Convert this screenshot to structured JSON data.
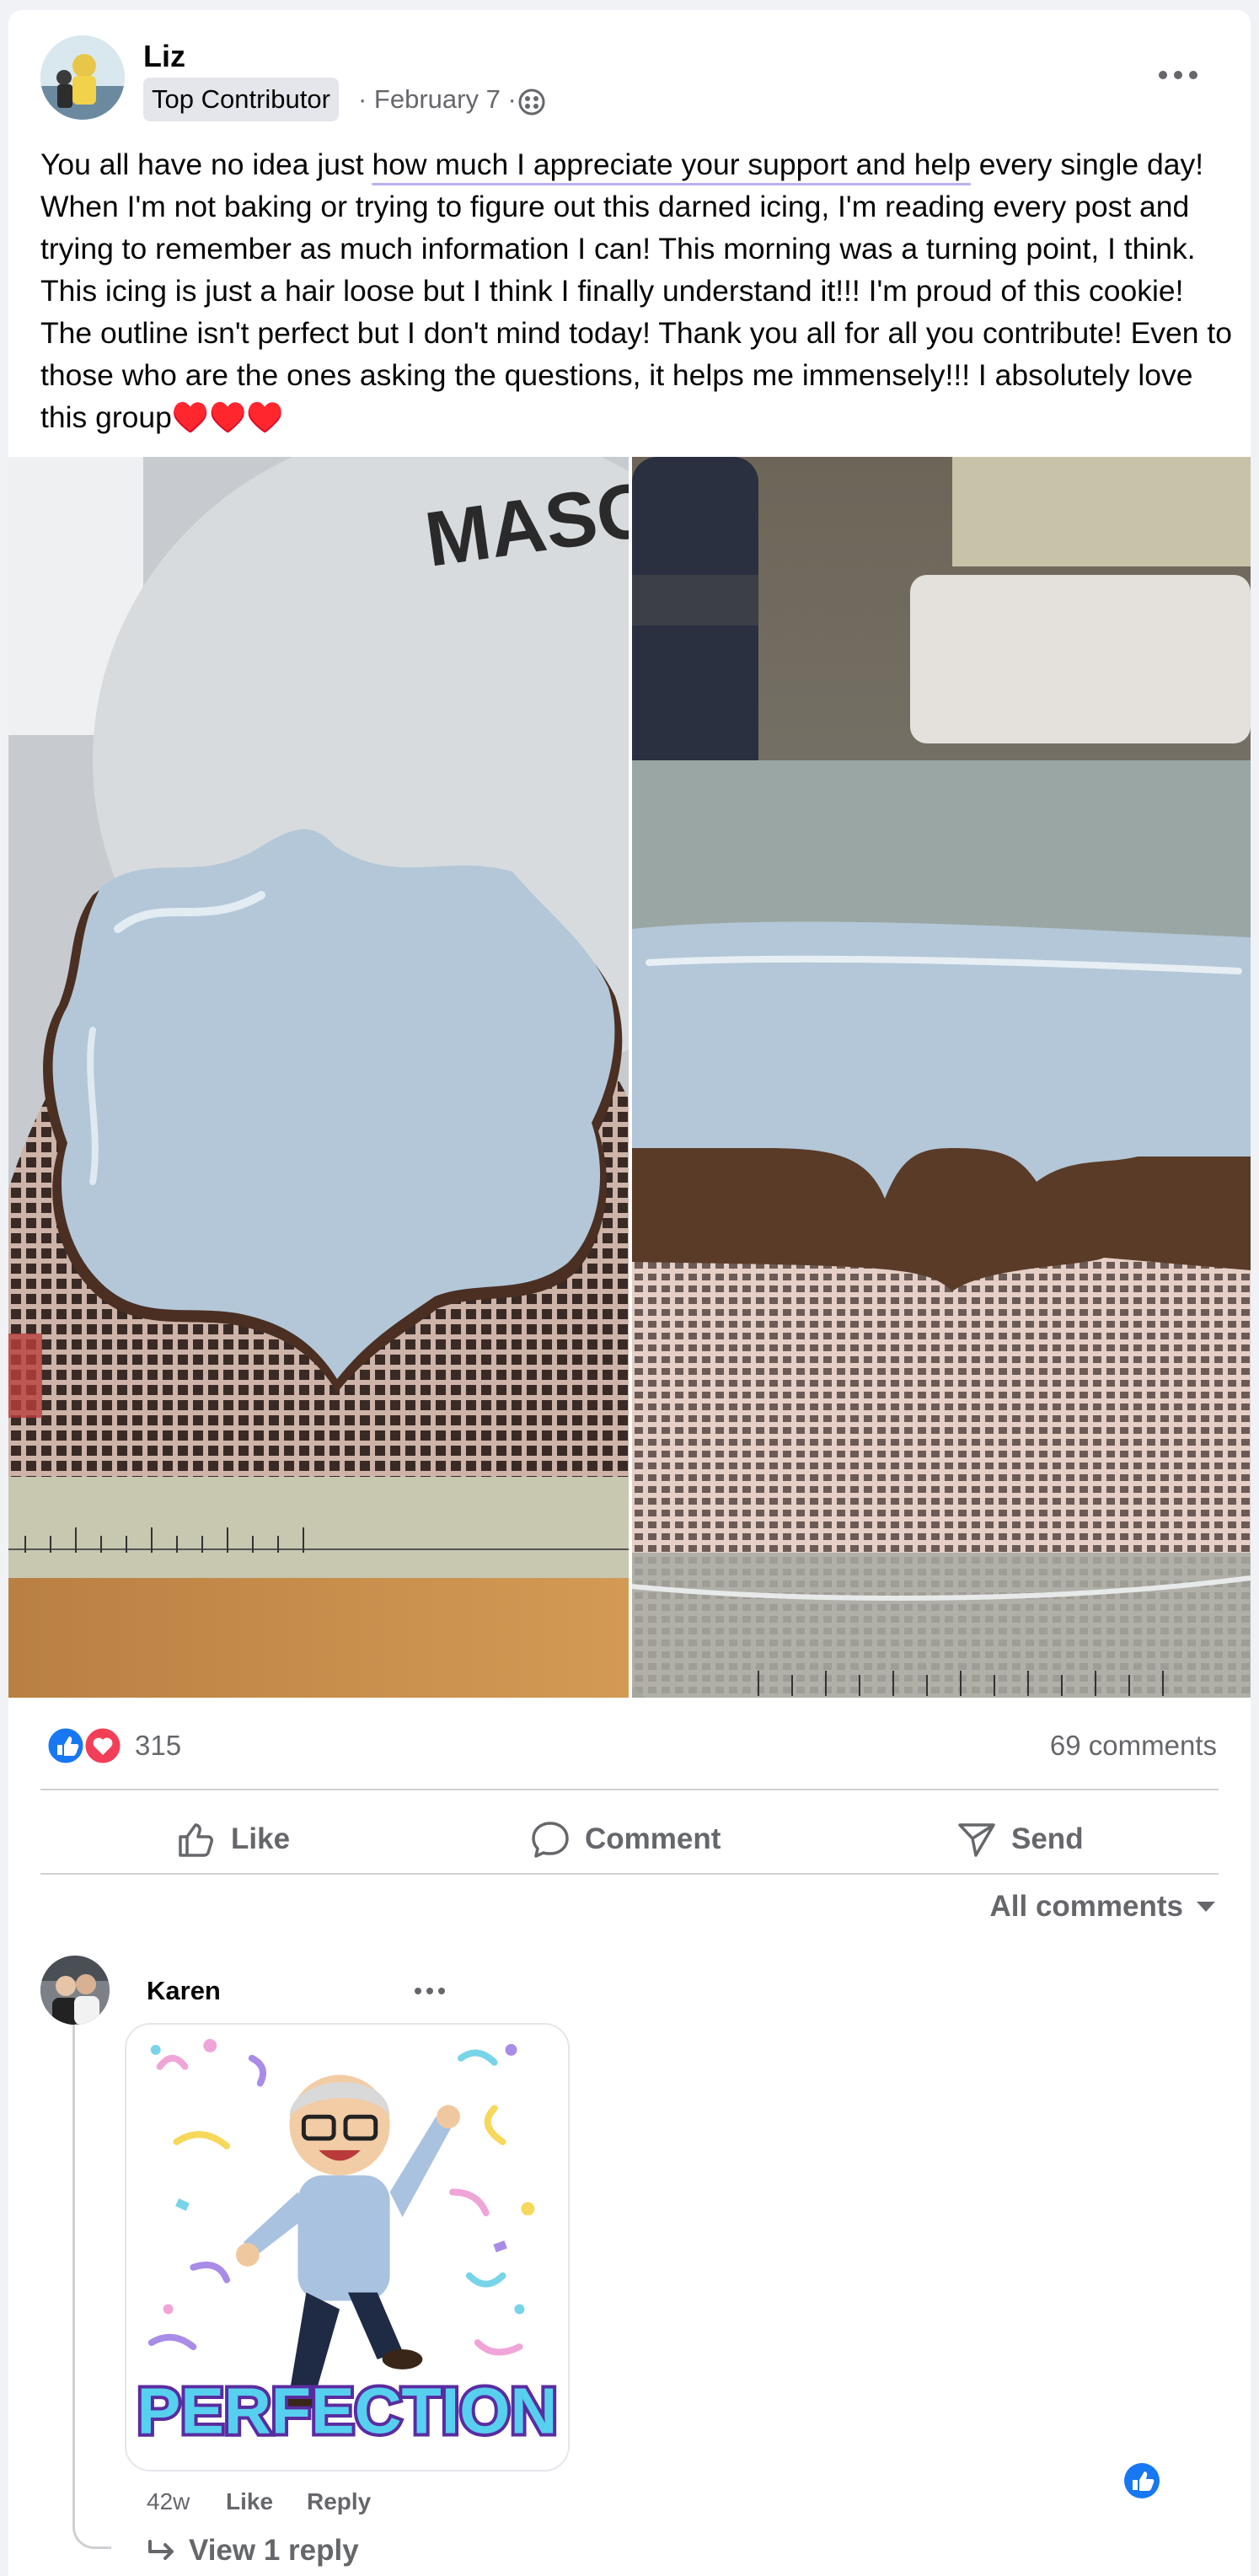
{
  "post": {
    "author": "Liz",
    "badge": "Top Contributor",
    "date": "· February 7 ·",
    "text_before": "You all have no idea just ",
    "text_underlined": "how much I appreciate your support and help",
    "text_after": " every single day! When I'm not baking or trying to figure out this darned icing, I'm reading every post and trying to remember as much information I can! This morning was a turning point, I think. This icing is just a hair loose but I think I finally understand it!!! I'm proud of this cookie! The outline isn't perfect but I don't mind today! Thank you all for all you contribute! Even to those who are the ones asking the questions, it helps me immensely!!! I absolutely love this group♥️♥️♥️",
    "photo_sign_text": "MASO",
    "reaction_count": "315",
    "comment_count": "69 comments"
  },
  "actions": {
    "like": "Like",
    "comment": "Comment",
    "send": "Send"
  },
  "filter_label": "All comments",
  "comment": {
    "author": "Karen",
    "sticker_text": "PERFECTION",
    "time": "42w",
    "like": "Like",
    "reply": "Reply",
    "view_replies": "View 1 reply"
  },
  "icons": {
    "privacy": "globe-icon",
    "more": "more-icon",
    "like_reaction": "like-reaction-icon",
    "love_reaction": "love-reaction-icon",
    "like_action": "thumbs-up-icon",
    "comment_action": "comment-bubble-icon",
    "send_action": "send-icon",
    "filter": "caret-down-icon",
    "reply_arrow": "reply-arrow-icon"
  },
  "colors": {
    "like_blue": "#1877f2",
    "love_red": "#f33e58",
    "secondary_text": "#65676b",
    "icing": "#b3c7d8"
  }
}
